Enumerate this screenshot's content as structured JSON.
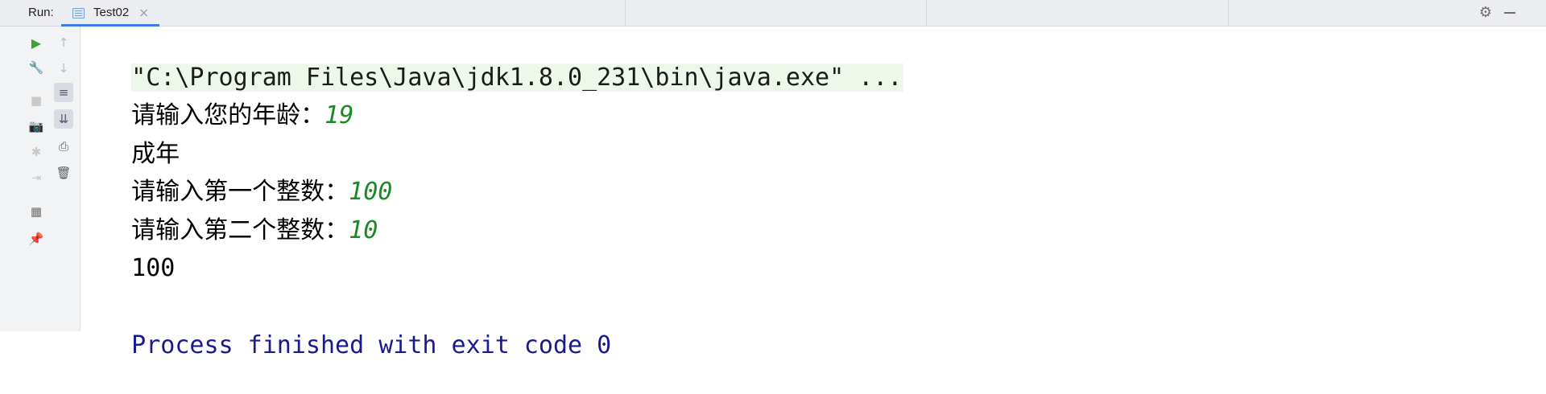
{
  "header": {
    "run_label": "Run:",
    "tab": {
      "label": "Test02",
      "close": "×"
    }
  },
  "side_tools": [
    {
      "name": "rerun-icon",
      "glyph": "▶",
      "color": "#3aa33a"
    },
    {
      "name": "wrench-icon",
      "glyph": "🔧",
      "color": "#6e6e6e"
    },
    {
      "name": "stop-icon",
      "glyph": "■",
      "color": "#c9c9c9"
    },
    {
      "name": "camera-icon",
      "glyph": "📷",
      "color": "#c9c9c9"
    },
    {
      "name": "debug-icon",
      "glyph": "✱",
      "color": "#c9c9c9"
    },
    {
      "name": "exit-icon",
      "glyph": "⇥",
      "color": "#c9c9c9"
    },
    {
      "name": "layout-icon",
      "glyph": "▦",
      "color": "#6e6e6e"
    },
    {
      "name": "pin-icon",
      "glyph": "📌",
      "color": "#6e6e6e"
    }
  ],
  "console_tools": [
    {
      "name": "up-arrow-icon",
      "glyph": "↑"
    },
    {
      "name": "down-arrow-icon",
      "glyph": "↓"
    },
    {
      "name": "soft-wrap-icon",
      "glyph": "≡"
    },
    {
      "name": "scroll-to-end-icon",
      "glyph": "⇊"
    },
    {
      "name": "print-icon",
      "glyph": "⎙"
    },
    {
      "name": "trash-icon",
      "glyph": "🗑"
    }
  ],
  "console": {
    "command": "\"C:\\Program Files\\Java\\jdk1.8.0_231\\bin\\java.exe\" ...",
    "lines": [
      {
        "prompt": "请输入您的年龄：",
        "input": "19"
      },
      {
        "text": "成年"
      },
      {
        "prompt": "请输入第一个整数：",
        "input": "100"
      },
      {
        "prompt": "请输入第二个整数：",
        "input": "10"
      },
      {
        "output": "100"
      }
    ],
    "exit_message": "Process finished with exit code 0"
  },
  "colors": {
    "header_bg": "#ebedf1",
    "tab_underline": "#3d7ce0",
    "command_bg": "#edf7ea",
    "user_input": "#1b8a24",
    "exit_text": "#1a1a8f"
  }
}
